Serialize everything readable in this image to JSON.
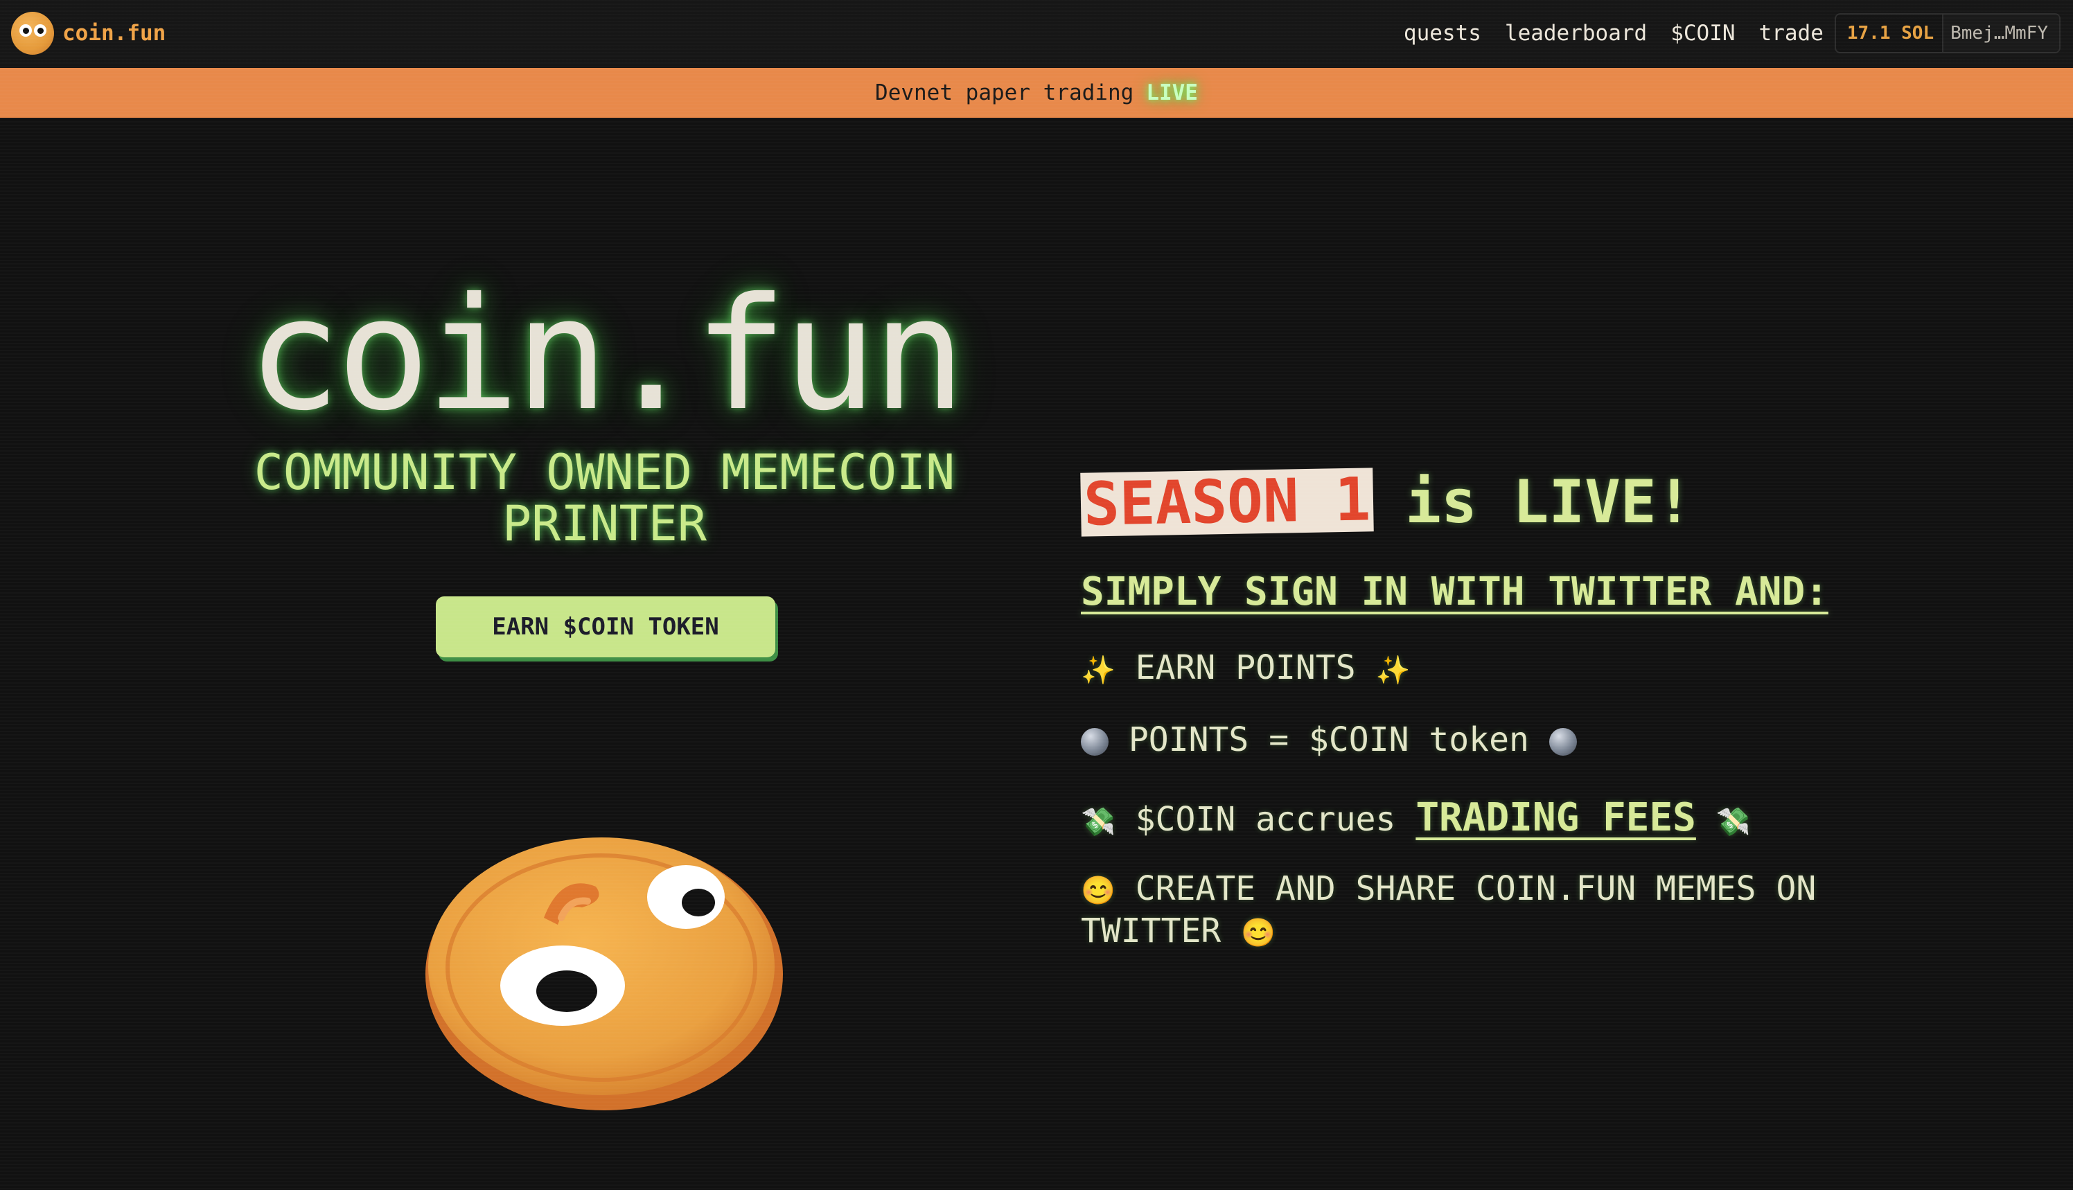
{
  "header": {
    "brand_name": "coin.fun",
    "nav": [
      "quests",
      "leaderboard",
      "$COIN",
      "trade"
    ],
    "wallet_balance": "17.1 SOL",
    "wallet_address": "Bmej…MmFY"
  },
  "banner": {
    "text": "Devnet paper trading",
    "live": "LIVE"
  },
  "hero": {
    "title": "coin.fun",
    "subtitle": "COMMUNITY OWNED MEMECOIN PRINTER",
    "cta": "EARN $COIN TOKEN"
  },
  "season": {
    "tag": "SEASON 1",
    "rest": "is LIVE!",
    "signin": "SIMPLY SIGN IN WITH TWITTER AND:",
    "line1": {
      "icon": "sparkles-icon",
      "text": "EARN POINTS"
    },
    "line2": {
      "icon": "globe-icon",
      "text": "POINTS = $COIN token"
    },
    "line3": {
      "icon": "money-wings-icon",
      "text_before": "$COIN accrues",
      "highlight": "TRADING FEES"
    },
    "line4": {
      "icon": "smiling-face-icon",
      "text": "CREATE AND SHARE COIN.FUN MEMES ON TWITTER"
    }
  },
  "colors": {
    "background": "#111111",
    "banner": "#e8894a",
    "brand": "#f0a347",
    "accent_green": "#c8e68a",
    "season_red": "#e2452c"
  }
}
